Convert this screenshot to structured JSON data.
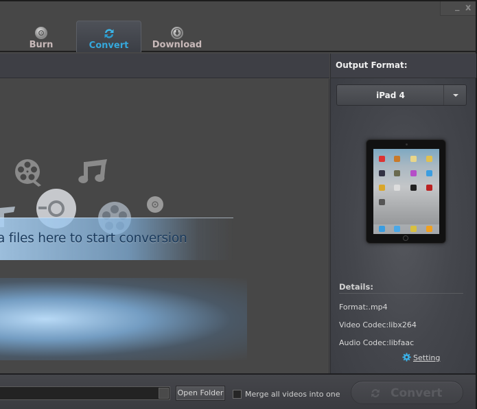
{
  "window": {
    "minimize_icon": "minimize-icon",
    "close_icon": "close-icon",
    "minimize_glyph": "_",
    "close_glyph": "x"
  },
  "tabs": [
    {
      "label": "Burn",
      "icon": "disc-icon",
      "active": false
    },
    {
      "label": "Convert",
      "icon": "refresh-arrows-icon",
      "active": true
    },
    {
      "label": "Download",
      "icon": "download-arrow-icon",
      "active": false
    }
  ],
  "drop_area": {
    "instruction": "Drag media files here to start conversion",
    "visible_instruction": "a files here to start conversion",
    "decorative_icons": [
      "film-reel-icon",
      "music-note-icon",
      "disc-icon",
      "film-reel-icon",
      "small-disc-icon"
    ]
  },
  "output_panel": {
    "title": "Output Format:",
    "selected_format": "iPad 4",
    "device_image": "ipad-device-image",
    "details_label": "Details:",
    "details": [
      "Format:.mp4",
      "Video Codec:libx264",
      "Audio Codec:libfaac"
    ],
    "setting_label": "Setting",
    "setting_icon": "gear-icon"
  },
  "bottom_bar": {
    "output_path": "",
    "open_folder_label": "Open Folder",
    "merge_label": "Merge all videos into one",
    "merge_checked": false,
    "convert_label": "Convert",
    "convert_enabled": false
  },
  "colors": {
    "accent": "#35a8dc",
    "tab_inactive_text": "#c8b9b9",
    "background": "#474747",
    "panel": "#3e3f45"
  }
}
